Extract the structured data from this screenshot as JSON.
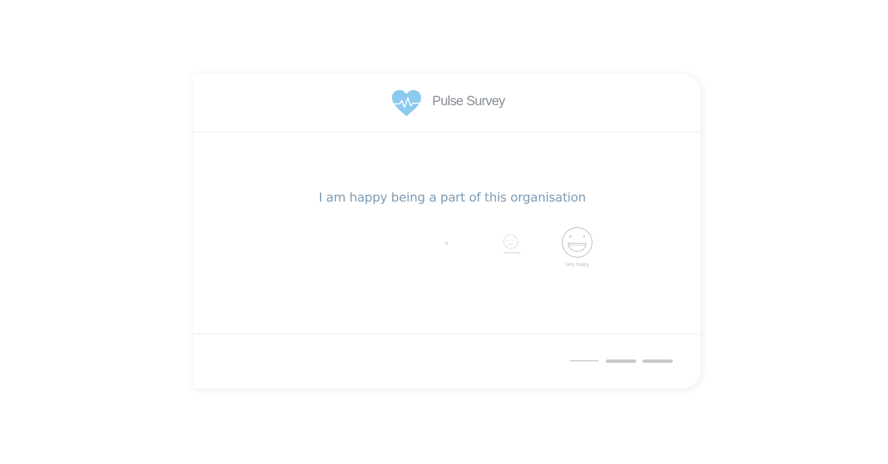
{
  "header": {
    "logo_icon": "heart-pulse-icon",
    "title": "Pulse Survey",
    "accent_color": "#8ccbef"
  },
  "question": {
    "text": "I am happy being a part of this organisation"
  },
  "answers": {
    "options": [
      {
        "icon": "dot-icon",
        "label": ""
      },
      {
        "icon": "neutral-face-icon",
        "label": ""
      },
      {
        "icon": "grinning-face-icon",
        "label": "Very happy"
      }
    ]
  },
  "progress": {
    "step_count": 3,
    "steps": [
      "step-1",
      "step-2",
      "step-3"
    ]
  }
}
